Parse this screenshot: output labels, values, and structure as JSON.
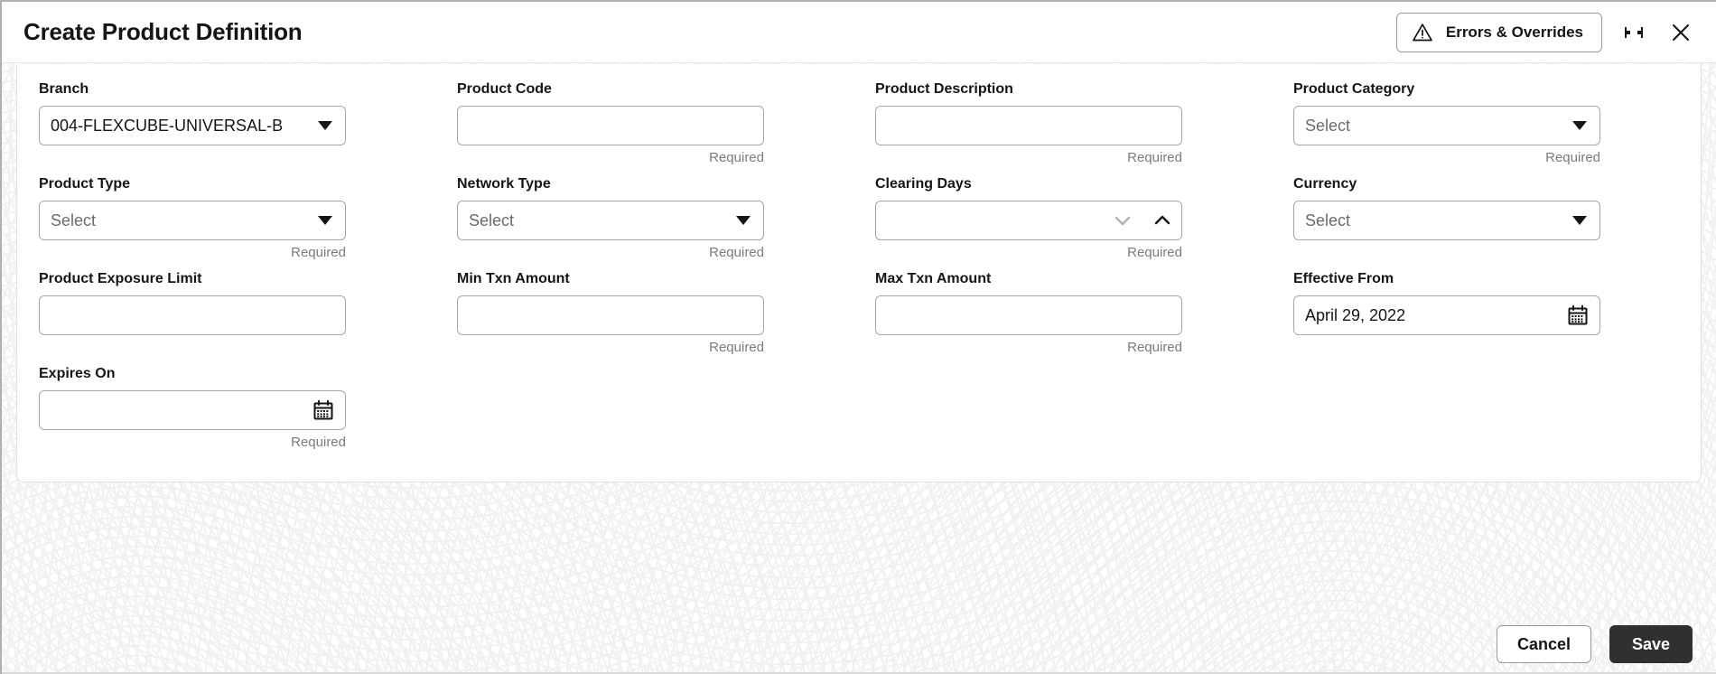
{
  "header": {
    "title": "Create Product Definition",
    "errors_button": "Errors & Overrides",
    "warning_icon": "warning-triangle-icon",
    "minimize_icon": "collapse-icon",
    "close_icon": "close-icon"
  },
  "colors": {
    "text": "#161513",
    "muted": "#7b7b7b",
    "border": "#a5a5a5",
    "card_border": "#e0e0e0",
    "save_bg": "#31302e",
    "pattern": "#f1f1f2"
  },
  "form": {
    "fields": [
      {
        "label": "Branch",
        "type": "select",
        "value": "004-FLEXCUBE-UNIVERSAL-B",
        "placeholder": "",
        "filled": true,
        "hint": "",
        "name": "branch"
      },
      {
        "label": "Product Code",
        "type": "text",
        "value": "",
        "placeholder": "",
        "filled": false,
        "hint": "Required",
        "name": "product-code"
      },
      {
        "label": "Product Description",
        "type": "text",
        "value": "",
        "placeholder": "",
        "filled": false,
        "hint": "Required",
        "name": "product-description"
      },
      {
        "label": "Product Category",
        "type": "select",
        "value": "Select",
        "placeholder": "Select",
        "filled": false,
        "hint": "Required",
        "name": "product-category"
      },
      {
        "label": "Product Type",
        "type": "select",
        "value": "Select",
        "placeholder": "Select",
        "filled": false,
        "hint": "Required",
        "name": "product-type"
      },
      {
        "label": "Network Type",
        "type": "select",
        "value": "Select",
        "placeholder": "Select",
        "filled": false,
        "hint": "Required",
        "name": "network-type"
      },
      {
        "label": "Clearing Days",
        "type": "stepper",
        "value": "",
        "placeholder": "",
        "filled": false,
        "hint": "Required",
        "name": "clearing-days"
      },
      {
        "label": "Currency",
        "type": "select",
        "value": "Select",
        "placeholder": "Select",
        "filled": false,
        "hint": "",
        "name": "currency"
      },
      {
        "label": "Product Exposure Limit",
        "type": "text",
        "value": "",
        "placeholder": "",
        "filled": false,
        "hint": "",
        "name": "product-exposure-limit"
      },
      {
        "label": "Min Txn Amount",
        "type": "text",
        "value": "",
        "placeholder": "",
        "filled": false,
        "hint": "Required",
        "name": "min-txn-amount"
      },
      {
        "label": "Max Txn Amount",
        "type": "text",
        "value": "",
        "placeholder": "",
        "filled": false,
        "hint": "Required",
        "name": "max-txn-amount"
      },
      {
        "label": "Effective From",
        "type": "date",
        "value": "April 29, 2022",
        "placeholder": "",
        "filled": true,
        "hint": "",
        "name": "effective-from"
      },
      {
        "label": "Expires On",
        "type": "date",
        "value": "",
        "placeholder": "",
        "filled": false,
        "hint": "Required",
        "name": "expires-on"
      }
    ]
  },
  "footer": {
    "cancel_label": "Cancel",
    "save_label": "Save"
  }
}
